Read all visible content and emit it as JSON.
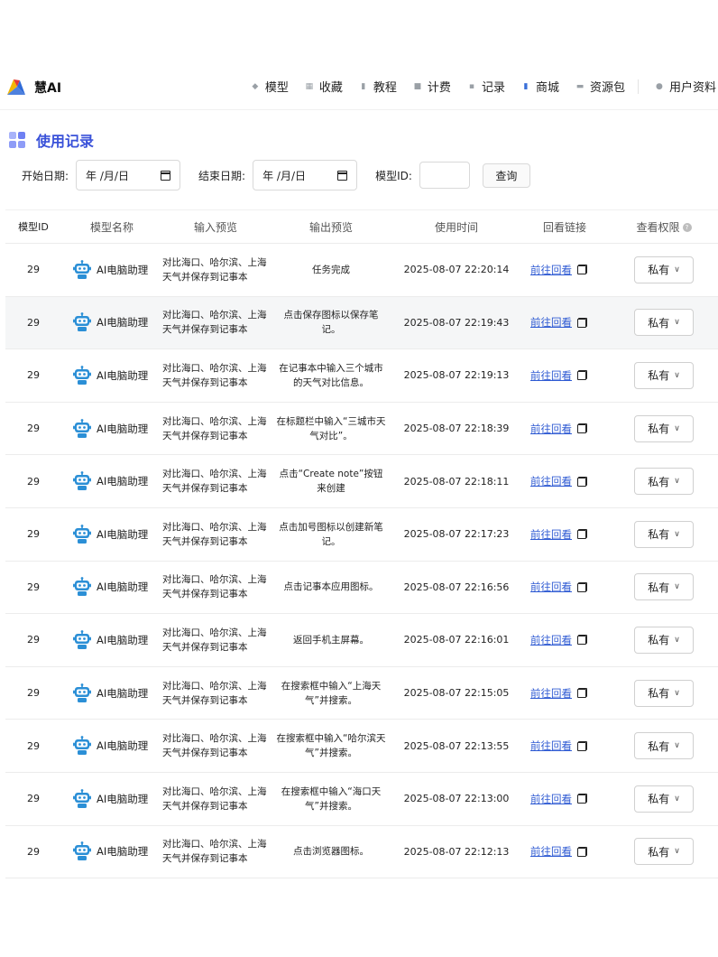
{
  "brand": {
    "name": "慧AI"
  },
  "nav": {
    "items": [
      {
        "label": "模型",
        "icon": "cube-icon"
      },
      {
        "label": "收藏",
        "icon": "grid-icon"
      },
      {
        "label": "教程",
        "icon": "book-icon"
      },
      {
        "label": "计费",
        "icon": "bill-icon"
      },
      {
        "label": "记录",
        "icon": "record-icon"
      },
      {
        "label": "商城",
        "icon": "store-icon"
      },
      {
        "label": "资源包",
        "icon": "package-icon"
      },
      {
        "label": "用户资料",
        "icon": "user-icon"
      }
    ]
  },
  "page": {
    "title": "使用记录"
  },
  "filters": {
    "start_label": "开始日期:",
    "start_value": "年 /月/日",
    "end_label": "结束日期:",
    "end_value": "年 /月/日",
    "model_id_label": "模型ID:",
    "query_label": "查询"
  },
  "table": {
    "headers": {
      "id": "模型ID",
      "name": "模型名称",
      "input": "输入预览",
      "output": "输出预览",
      "time": "使用时间",
      "link": "回看链接",
      "perm": "查看权限",
      "perm_help": "?"
    },
    "rows": [
      {
        "id": "29",
        "name": "AI电脑助理",
        "input": "对比海口、哈尔滨、上海天气并保存到记事本",
        "output": "任务完成",
        "time": "2025-08-07 22:20:14",
        "link": "前往回看",
        "perm": "私有"
      },
      {
        "id": "29",
        "name": "AI电脑助理",
        "input": "对比海口、哈尔滨、上海天气并保存到记事本",
        "output": "点击保存图标以保存笔记。",
        "time": "2025-08-07 22:19:43",
        "link": "前往回看",
        "perm": "私有"
      },
      {
        "id": "29",
        "name": "AI电脑助理",
        "input": "对比海口、哈尔滨、上海天气并保存到记事本",
        "output": "在记事本中输入三个城市的天气对比信息。",
        "time": "2025-08-07 22:19:13",
        "link": "前往回看",
        "perm": "私有"
      },
      {
        "id": "29",
        "name": "AI电脑助理",
        "input": "对比海口、哈尔滨、上海天气并保存到记事本",
        "output": "在标题栏中输入“三城市天气对比”。",
        "time": "2025-08-07 22:18:39",
        "link": "前往回看",
        "perm": "私有"
      },
      {
        "id": "29",
        "name": "AI电脑助理",
        "input": "对比海口、哈尔滨、上海天气并保存到记事本",
        "output": "点击“Create note”按钮来创建",
        "time": "2025-08-07 22:18:11",
        "link": "前往回看",
        "perm": "私有"
      },
      {
        "id": "29",
        "name": "AI电脑助理",
        "input": "对比海口、哈尔滨、上海天气并保存到记事本",
        "output": "点击加号图标以创建新笔记。",
        "time": "2025-08-07 22:17:23",
        "link": "前往回看",
        "perm": "私有"
      },
      {
        "id": "29",
        "name": "AI电脑助理",
        "input": "对比海口、哈尔滨、上海天气并保存到记事本",
        "output": "点击记事本应用图标。",
        "time": "2025-08-07 22:16:56",
        "link": "前往回看",
        "perm": "私有"
      },
      {
        "id": "29",
        "name": "AI电脑助理",
        "input": "对比海口、哈尔滨、上海天气并保存到记事本",
        "output": "返回手机主屏幕。",
        "time": "2025-08-07 22:16:01",
        "link": "前往回看",
        "perm": "私有"
      },
      {
        "id": "29",
        "name": "AI电脑助理",
        "input": "对比海口、哈尔滨、上海天气并保存到记事本",
        "output": "在搜索框中输入“上海天气”并搜索。",
        "time": "2025-08-07 22:15:05",
        "link": "前往回看",
        "perm": "私有"
      },
      {
        "id": "29",
        "name": "AI电脑助理",
        "input": "对比海口、哈尔滨、上海天气并保存到记事本",
        "output": "在搜索框中输入“哈尔滨天气”并搜索。",
        "time": "2025-08-07 22:13:55",
        "link": "前往回看",
        "perm": "私有"
      },
      {
        "id": "29",
        "name": "AI电脑助理",
        "input": "对比海口、哈尔滨、上海天气并保存到记事本",
        "output": "在搜索框中输入“海口天气”并搜索。",
        "time": "2025-08-07 22:13:00",
        "link": "前往回看",
        "perm": "私有"
      },
      {
        "id": "29",
        "name": "AI电脑助理",
        "input": "对比海口、哈尔滨、上海天气并保存到记事本",
        "output": "点击浏览器图标。",
        "time": "2025-08-07 22:12:13",
        "link": "前往回看",
        "perm": "私有"
      }
    ]
  },
  "colors": {
    "accent": "#3a52d9",
    "link": "#2f5bd3",
    "row_alt": "#f5f6f7"
  }
}
